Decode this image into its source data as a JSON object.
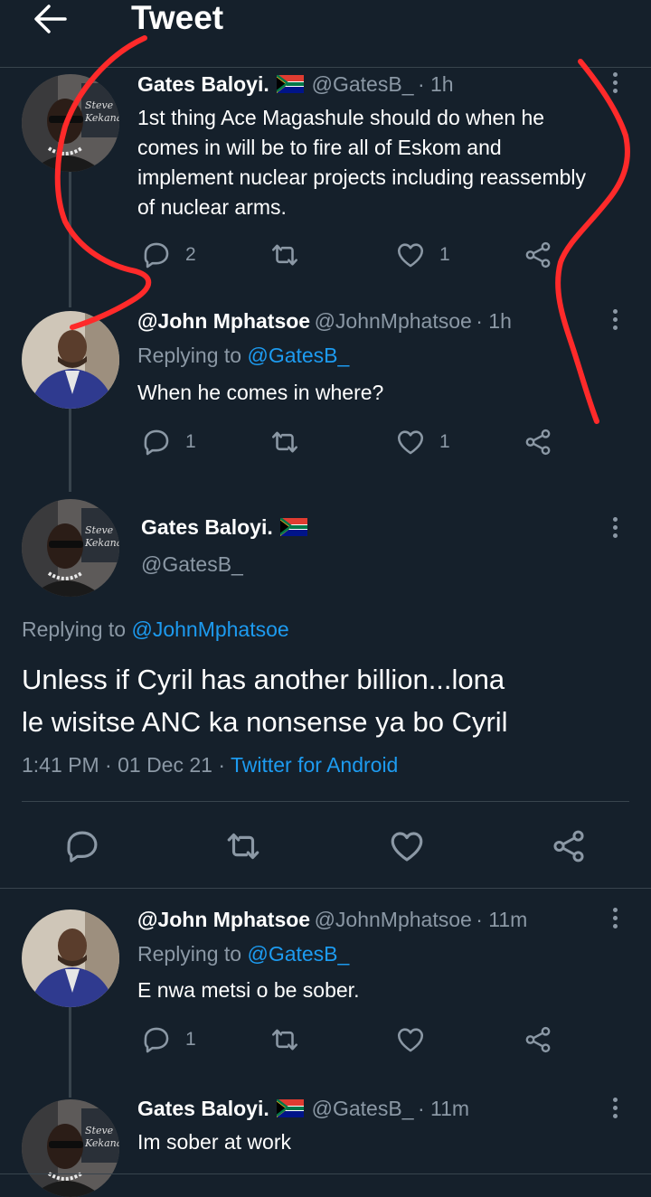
{
  "header": {
    "title": "Tweet"
  },
  "tweet1": {
    "name": "Gates Baloyi.",
    "handle": "@GatesB_",
    "time": "· 1h",
    "lines": [
      "1st thing Ace Magashule should do when he",
      "comes in will be to fire all of Eskom and",
      "implement nuclear projects including reassembly",
      "of nuclear arms."
    ],
    "reply_count": "2",
    "like_count": "1"
  },
  "tweet2": {
    "name": "@John Mphatsoe",
    "handle": "@JohnMphatsoe",
    "time": "· 1h",
    "replying_prefix": "Replying to",
    "replying_to": "@GatesB_",
    "text": "When he comes in where?",
    "reply_count": "1",
    "like_count": "1"
  },
  "main": {
    "name": "Gates Baloyi.",
    "handle": "@GatesB_",
    "replying_prefix": "Replying to",
    "replying_to": "@JohnMphatsoe",
    "lines": [
      "Unless if Cyril has another billion...lona",
      "le wisitse ANC ka nonsense ya bo Cyril"
    ],
    "time": "1:41 PM · 01 Dec 21 ·",
    "source": "Twitter for Android"
  },
  "tweet3": {
    "name": "@John Mphatsoe",
    "handle": "@JohnMphatsoe",
    "time": "· 11m",
    "replying_prefix": "Replying to",
    "replying_to": "@GatesB_",
    "text": "E nwa metsi o be sober.",
    "reply_count": "1"
  },
  "tweet4": {
    "name": "Gates Baloyi.",
    "handle": "@GatesB_",
    "time": "· 11m",
    "text": "Im sober at work"
  },
  "colors": {
    "background": "#15202b",
    "accent": "#1d9bf0",
    "muted": "#8b98a5",
    "annotation": "#ff2a2a"
  }
}
